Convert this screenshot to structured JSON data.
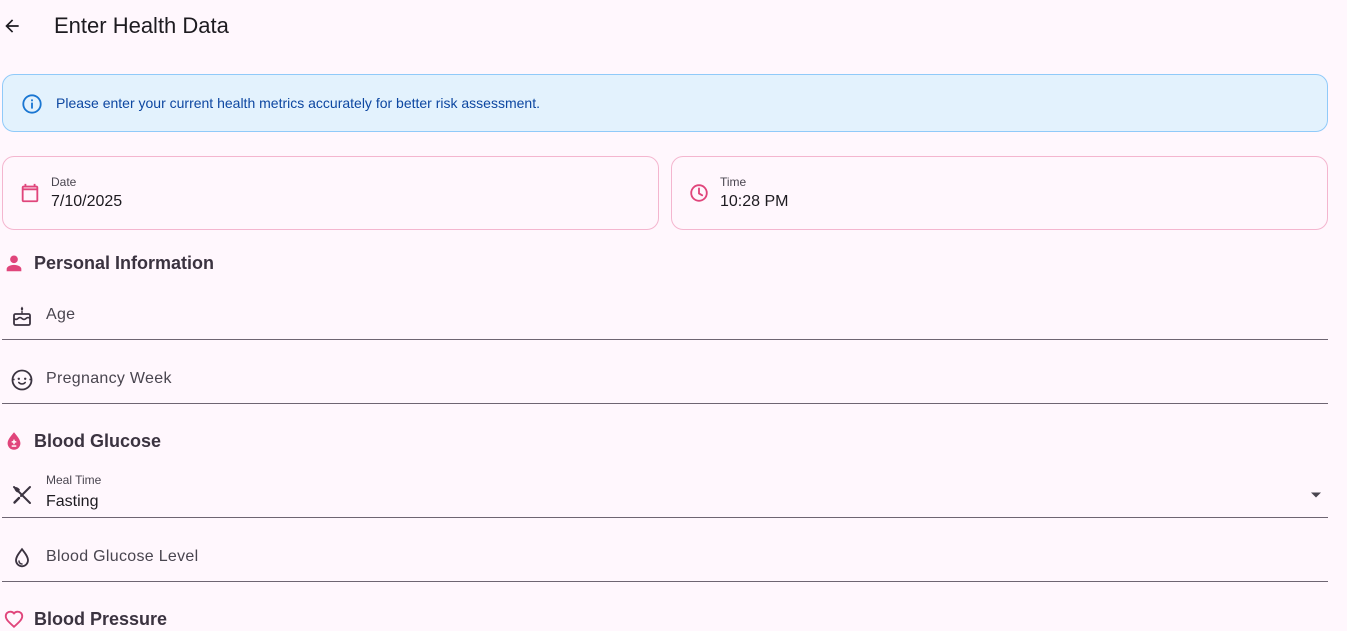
{
  "appbar": {
    "title": "Enter Health Data",
    "back_icon": "arrow-back-icon"
  },
  "info_banner": {
    "text": "Please enter your current health metrics accurately for better risk assessment.",
    "icon": "info-icon",
    "color": "#0d47a1",
    "background": "#e3f2fd"
  },
  "date_card": {
    "label": "Date",
    "value": "7/10/2025",
    "icon": "calendar-icon"
  },
  "time_card": {
    "label": "Time",
    "value": "10:28 PM",
    "icon": "clock-icon"
  },
  "sections": {
    "personal": {
      "title": "Personal Information",
      "icon": "person-icon"
    },
    "glucose": {
      "title": "Blood Glucose",
      "icon": "blood-drop-icon"
    },
    "pressure": {
      "title": "Blood Pressure",
      "icon": "heart-icon"
    }
  },
  "fields": {
    "age": {
      "placeholder": "Age",
      "icon": "cake-icon"
    },
    "pregnancy_week": {
      "placeholder": "Pregnancy Week",
      "icon": "baby-face-icon"
    },
    "meal_time": {
      "label": "Meal Time",
      "value": "Fasting",
      "icon": "fork-knife-icon"
    },
    "glucose_level": {
      "placeholder": "Blood Glucose Level",
      "icon": "water-drop-icon"
    }
  },
  "colors": {
    "accent": "#e0457b",
    "background": "#fff7fd",
    "card_border": "#f4b6cf"
  }
}
